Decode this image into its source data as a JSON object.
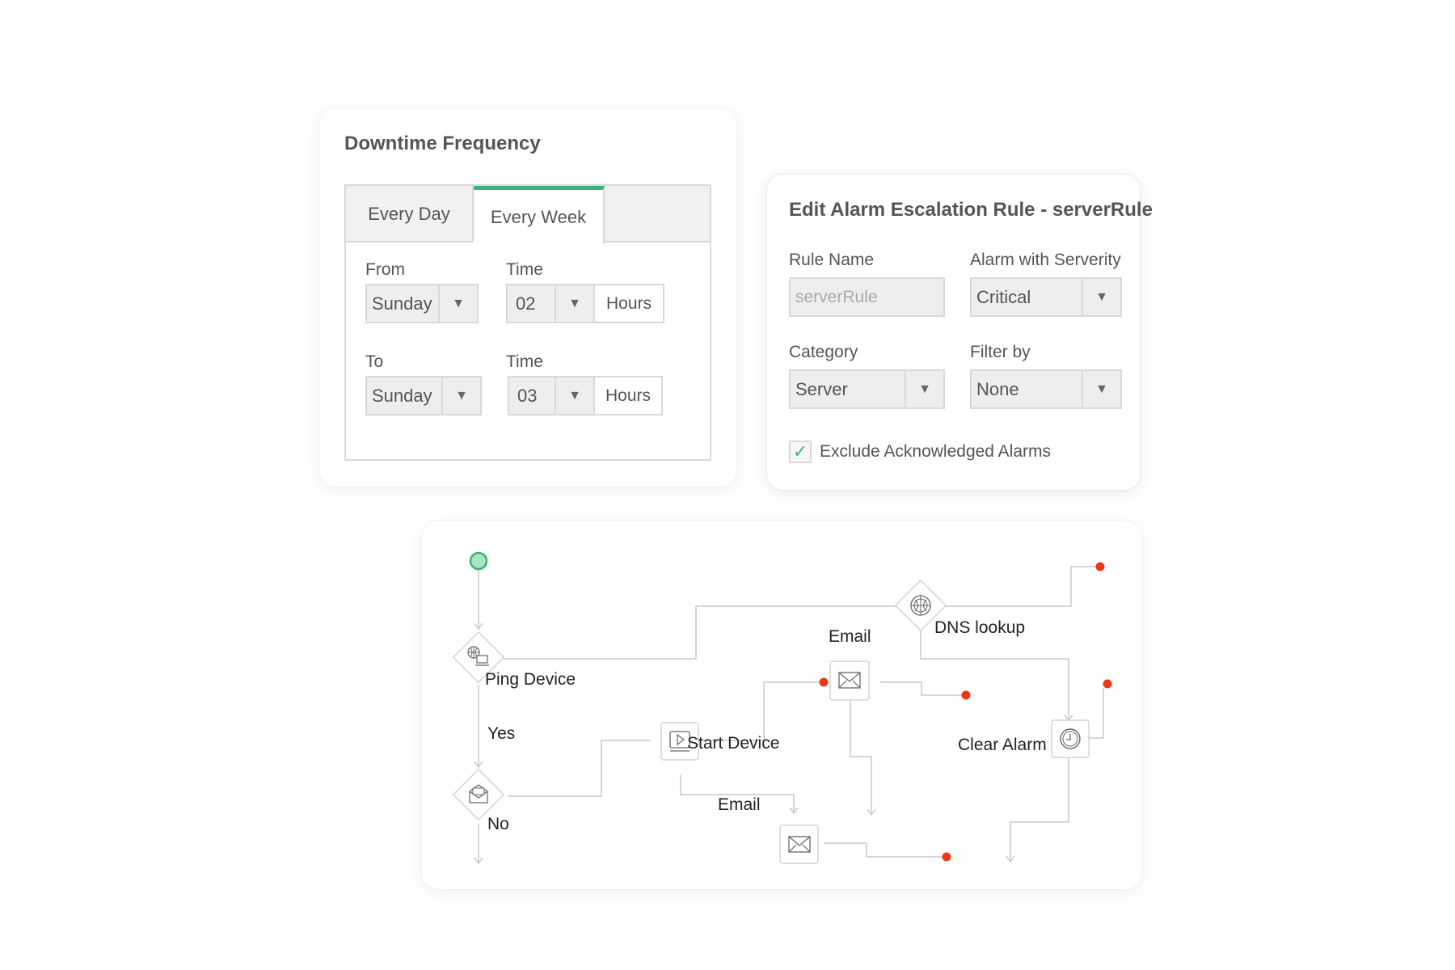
{
  "downtime": {
    "title": "Downtime Frequency",
    "tabs": [
      {
        "label": "Every Day",
        "active": false
      },
      {
        "label": "Every Week",
        "active": true
      }
    ],
    "from_label": "From",
    "from_day": "Sunday",
    "from_time_label": "Time",
    "from_time": "02",
    "from_unit": "Hours",
    "to_label": "To",
    "to_day": "Sunday",
    "to_time_label": "Time",
    "to_time": "03",
    "to_unit": "Hours"
  },
  "alarm": {
    "title": "Edit Alarm Escalation Rule - serverRule",
    "rule_name_label": "Rule Name",
    "rule_name_placeholder": "serverRule",
    "severity_label": "Alarm with Serverity",
    "severity_value": "Critical",
    "category_label": "Category",
    "category_value": "Server",
    "filter_label": "Filter by",
    "filter_value": "None",
    "exclude_label": "Exclude Acknowledged Alarms",
    "exclude_checked": true,
    "check_glyph": "✓"
  },
  "flow": {
    "nodes": {
      "ping": "Ping Device",
      "yes": "Yes",
      "no": "No",
      "start": "Start Device",
      "email_top": "Email",
      "email_bottom": "Email",
      "dns": "DNS lookup",
      "clear": "Clear Alarm"
    },
    "colors": {
      "start_dot": "#3bb37a",
      "end_dot": "#e8391a",
      "line": "#c9c9c9"
    },
    "icons": [
      "ping-device-icon",
      "decision-mail-icon",
      "start-device-icon",
      "email-icon",
      "dns-globe-icon",
      "clock-icon"
    ]
  },
  "icons": {
    "dropdown_arrow": "▼"
  }
}
